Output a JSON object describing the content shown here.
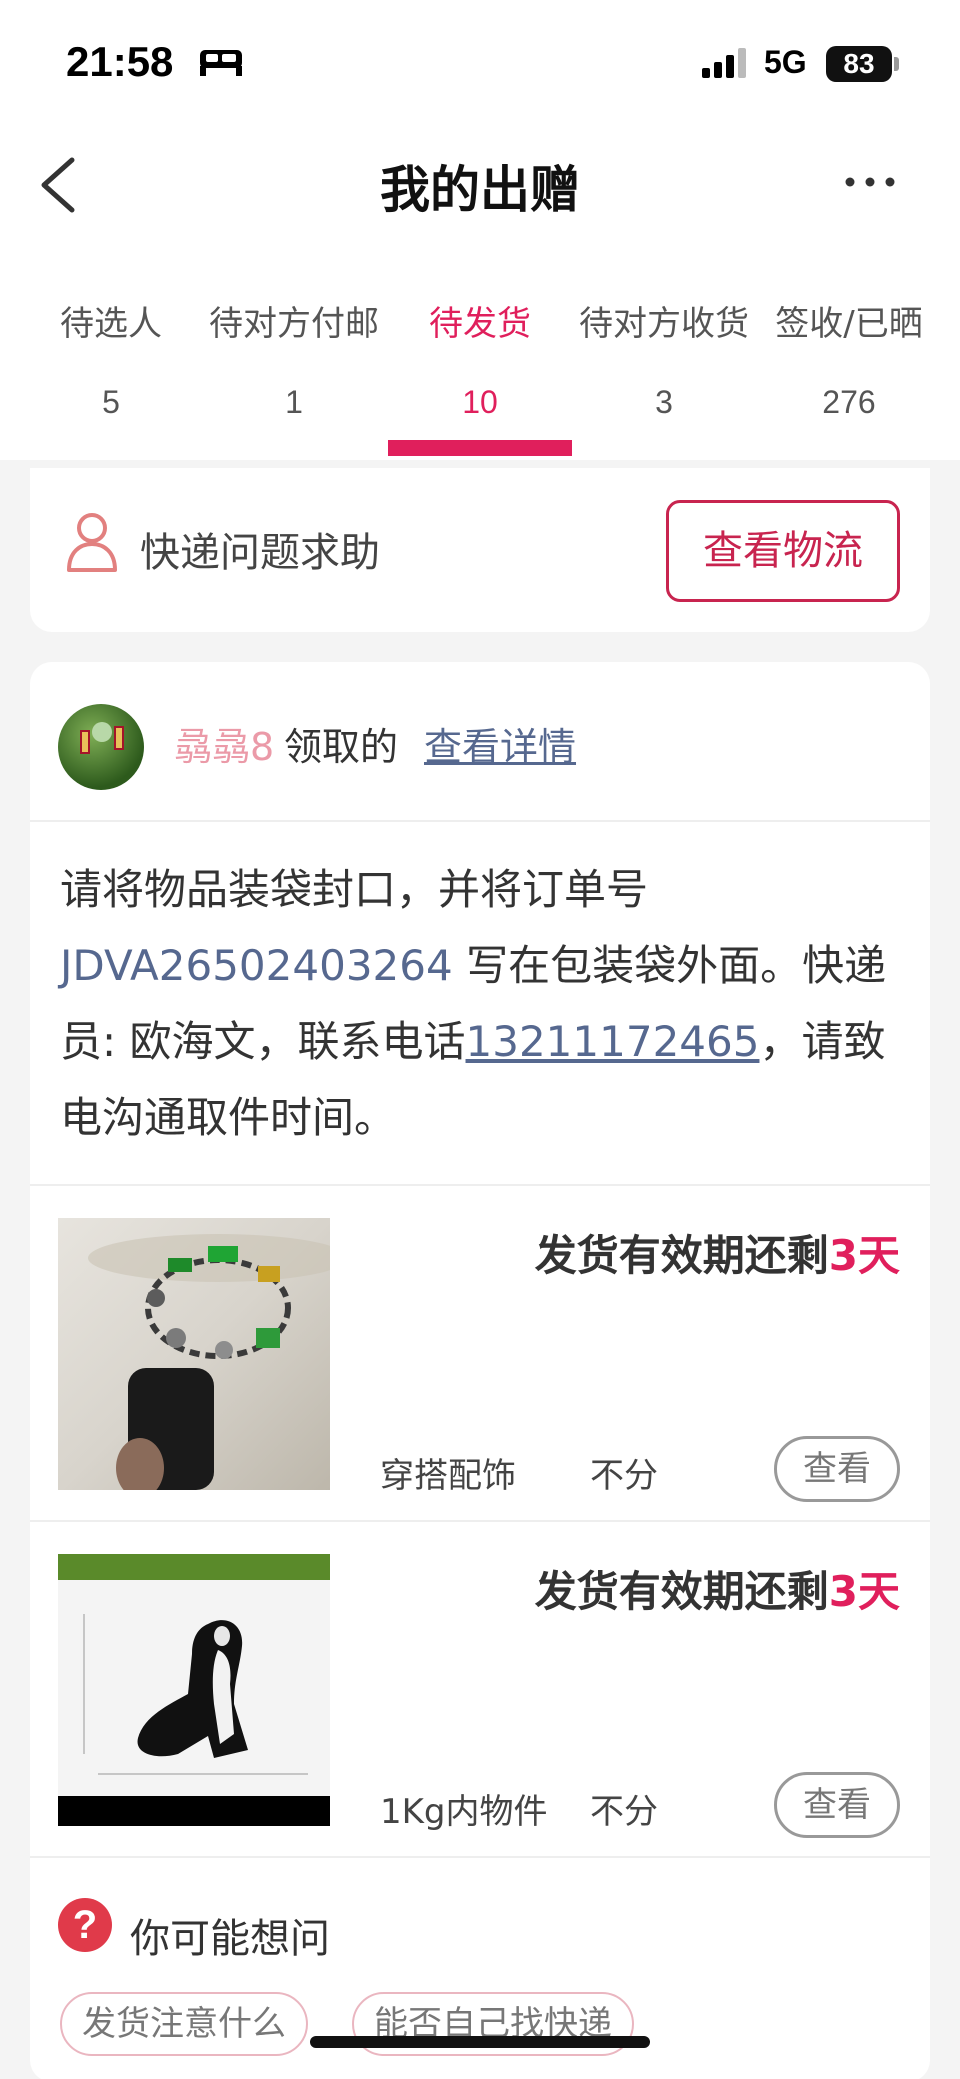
{
  "status_bar": {
    "time": "21:58",
    "network": "5G",
    "battery": "83"
  },
  "nav": {
    "title": "我的出赠",
    "back_icon": "chevron-left-icon",
    "more_icon": "more-dots-icon"
  },
  "tabs": [
    {
      "label": "待选人",
      "count": "5",
      "active": false
    },
    {
      "label": "待对方付邮",
      "count": "1",
      "active": false
    },
    {
      "label": "待发货",
      "count": "10",
      "active": true
    },
    {
      "label": "待对方收货",
      "count": "3",
      "active": false
    },
    {
      "label": "签收/已晒",
      "count": "276",
      "active": false
    }
  ],
  "help": {
    "label": "快递问题求助",
    "button": "查看物流"
  },
  "order": {
    "receiver_name": "骉骉8",
    "receiver_suffix": "领取的",
    "details_link": "查看详情",
    "notice": {
      "part1": "请将物品装袋封口，并将订单号 ",
      "order_no": "JDVA26502403264",
      "part2": " 写在包装袋外面。快递员: 欧海文，联系电话",
      "phone": "13211172465",
      "part3": "，请致电沟通取件时间。"
    },
    "items": [
      {
        "deadline_prefix": "发货有效期还剩",
        "deadline_days": "3天",
        "category": "穿搭配饰",
        "mode": "不分",
        "view": "查看"
      },
      {
        "deadline_prefix": "发货有效期还剩",
        "deadline_days": "3天",
        "category": "1Kg内物件",
        "mode": "不分",
        "view": "查看"
      }
    ]
  },
  "faq": {
    "title": "你可能想问",
    "chips": [
      "发货注意什么",
      "能否自己找快递"
    ]
  },
  "colors": {
    "accent": "#e01f5c",
    "link": "#56688f",
    "button_border": "#c8244f"
  }
}
